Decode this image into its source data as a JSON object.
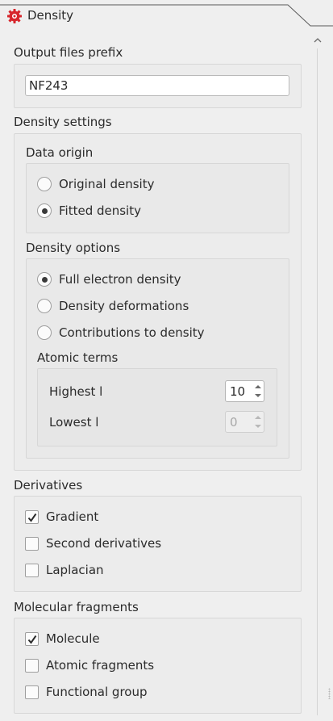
{
  "panel": {
    "title": "Density",
    "icon": "gear-icon",
    "accent": "#d7262c"
  },
  "output": {
    "label": "Output files prefix",
    "value": "NF243"
  },
  "density_settings": {
    "label": "Density settings",
    "data_origin": {
      "label": "Data origin",
      "options": [
        {
          "label": "Original density",
          "checked": false
        },
        {
          "label": "Fitted density",
          "checked": true
        }
      ]
    },
    "density_options": {
      "label": "Density options",
      "options": [
        {
          "label": "Full electron density",
          "checked": true
        },
        {
          "label": "Density deformations",
          "checked": false
        },
        {
          "label": "Contributions to density",
          "checked": false
        }
      ],
      "atomic_terms": {
        "label": "Atomic terms",
        "highest": {
          "label": "Highest l",
          "value": "10",
          "enabled": true
        },
        "lowest": {
          "label": "Lowest l",
          "value": "0",
          "enabled": false
        }
      }
    }
  },
  "derivatives": {
    "label": "Derivatives",
    "items": [
      {
        "label": "Gradient",
        "checked": true
      },
      {
        "label": "Second derivatives",
        "checked": false
      },
      {
        "label": "Laplacian",
        "checked": false
      }
    ]
  },
  "fragments": {
    "label": "Molecular fragments",
    "items": [
      {
        "label": "Molecule",
        "checked": true
      },
      {
        "label": "Atomic fragments",
        "checked": false
      },
      {
        "label": "Functional group",
        "checked": false
      }
    ]
  }
}
